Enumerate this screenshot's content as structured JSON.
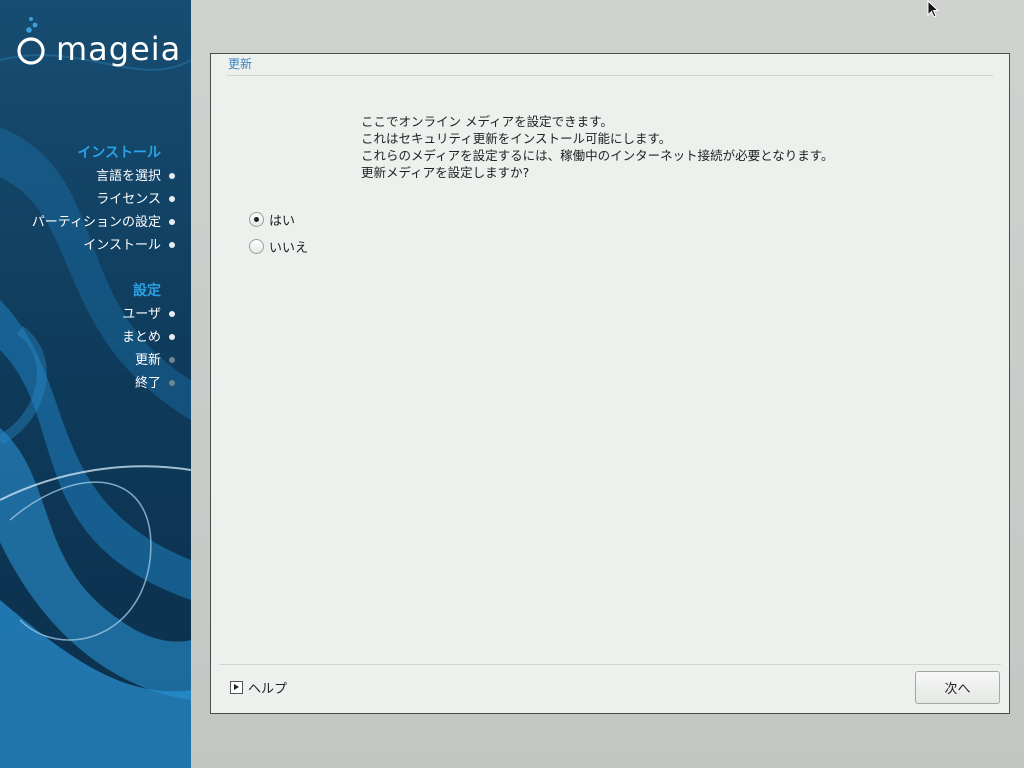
{
  "sidebar": {
    "logo_text": "mageia",
    "sections": [
      {
        "heading": "インストール",
        "items": [
          {
            "label": "言語を選択",
            "state": "done"
          },
          {
            "label": "ライセンス",
            "state": "done"
          },
          {
            "label": "パーティションの設定",
            "state": "done"
          },
          {
            "label": "インストール",
            "state": "done"
          }
        ]
      },
      {
        "heading": "設定",
        "items": [
          {
            "label": "ユーザ",
            "state": "done"
          },
          {
            "label": "まとめ",
            "state": "done"
          },
          {
            "label": "更新",
            "state": "pending"
          },
          {
            "label": "終了",
            "state": "pending"
          }
        ]
      }
    ]
  },
  "panel": {
    "title": "更新",
    "description": [
      "ここでオンライン メディアを設定できます。",
      "これはセキュリティ更新をインストール可能にします。",
      "これらのメディアを設定するには、稼働中のインターネット接続が必要となります。",
      "更新メディアを設定しますか?"
    ],
    "options": [
      {
        "label": "はい",
        "selected": true
      },
      {
        "label": "いいえ",
        "selected": false
      }
    ],
    "help_label": "ヘルプ",
    "next_label": "次へ"
  },
  "colors": {
    "sidebar_bg": "#0f3550",
    "section_heading": "#2aa3e6",
    "panel_title": "#3f7fc2",
    "panel_bg": "#edf1ed"
  }
}
